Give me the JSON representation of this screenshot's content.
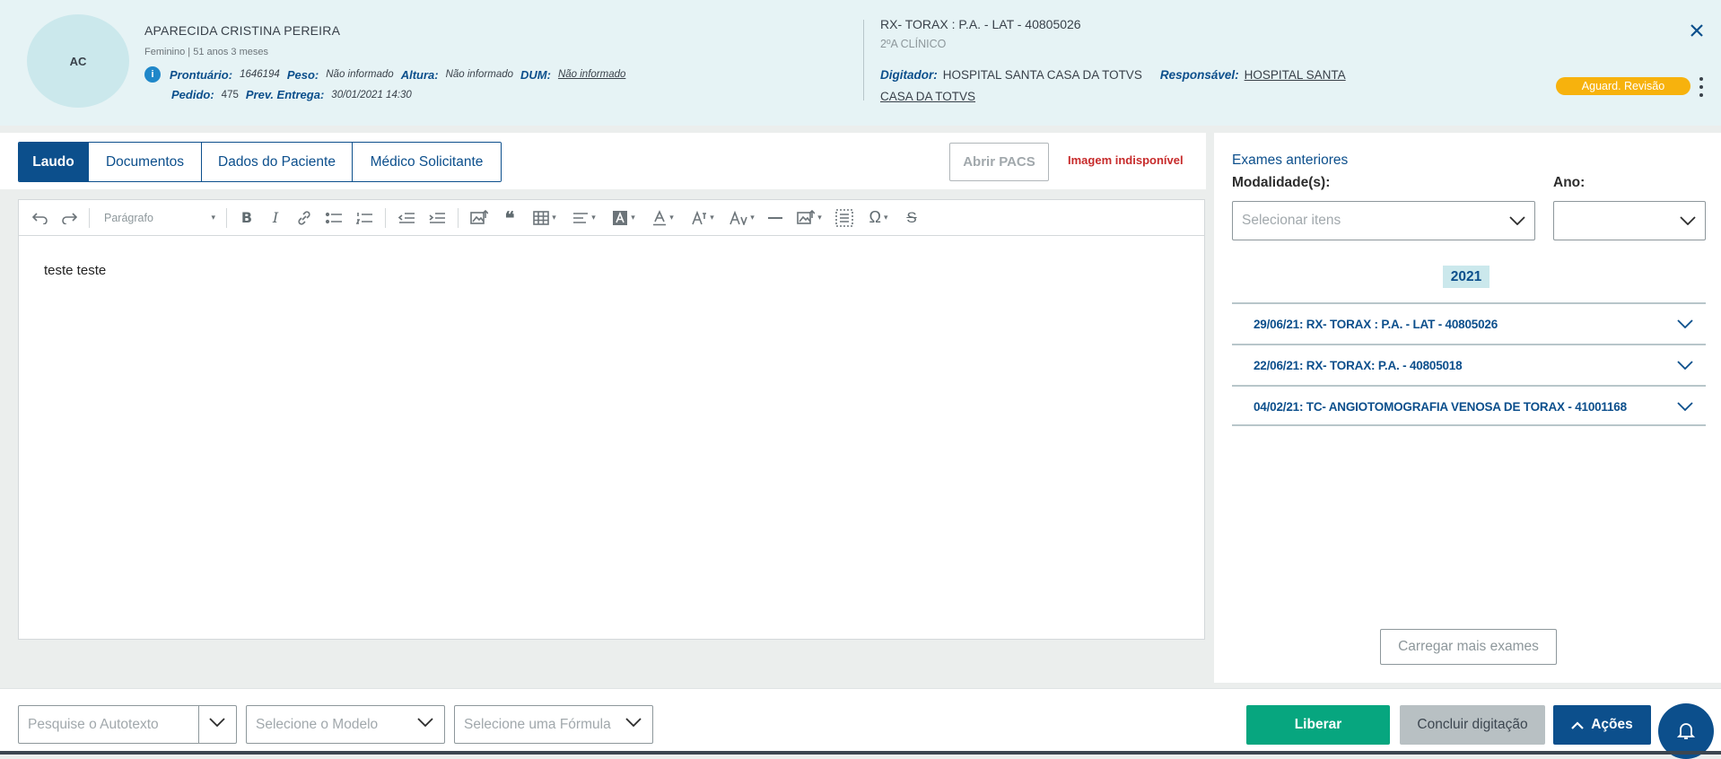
{
  "patient": {
    "initials": "AC",
    "name": "APARECIDA CRISTINA PEREIRA",
    "meta": "Feminino | 51 anos 3 meses",
    "prontuario_label": "Prontuário:",
    "prontuario": "1646194",
    "peso_label": "Peso:",
    "peso": "Não informado",
    "altura_label": "Altura:",
    "altura": "Não informado",
    "dum_label": "DUM:",
    "dum": "Não informado",
    "pedido_label": "Pedido:",
    "pedido": "475",
    "prev_label": "Prev. Entrega:",
    "prev": "30/01/2021 14:30"
  },
  "exam": {
    "title": "RX- TORAX : P.A. - LAT - 40805026",
    "subtitle": "2ºA CLÍNICO",
    "digitador_label": "Digitador:",
    "digitador": "HOSPITAL SANTA CASA DA TOTVS",
    "responsavel_label": "Responsável:",
    "responsavel_line1": "HOSPITAL SANTA",
    "responsavel_line2": "CASA DA TOTVS"
  },
  "status": "Aguard. Revisão",
  "tabs": [
    {
      "label": "Laudo",
      "active": true
    },
    {
      "label": "Documentos",
      "active": false
    },
    {
      "label": "Dados do Paciente",
      "active": false
    },
    {
      "label": "Médico Solicitante",
      "active": false
    }
  ],
  "pacs_button": "Abrir PACS",
  "image_unavailable": "Imagem indisponível",
  "editor": {
    "paragraph_select": "Parágrafo",
    "content": "teste teste"
  },
  "previous_exams": {
    "title": "Exames anteriores",
    "modalidade_label": "Modalidade(s):",
    "modalidade_placeholder": "Selecionar itens",
    "ano_label": "Ano:",
    "ano_value": "",
    "year": "2021",
    "items": [
      "29/06/21: RX- TORAX : P.A. - LAT - 40805026",
      "22/06/21: RX- TORAX: P.A. - 40805018",
      "04/02/21: TC- ANGIOTOMOGRAFIA VENOSA DE TORAX - 41001168"
    ],
    "load_more": "Carregar mais exames"
  },
  "footer": {
    "autotexto_placeholder": "Pesquise o Autotexto",
    "modelo_placeholder": "Selecione o Modelo",
    "formula_placeholder": "Selecione uma Fórmula",
    "liberar": "Liberar",
    "concluir": "Concluir digitação",
    "acoes": "Ações"
  },
  "colors": {
    "primary": "#0c4f8c",
    "success": "#07a67f",
    "warning": "#f7b20d",
    "danger": "#c72b2b",
    "header_bg": "#e6f3f5"
  }
}
